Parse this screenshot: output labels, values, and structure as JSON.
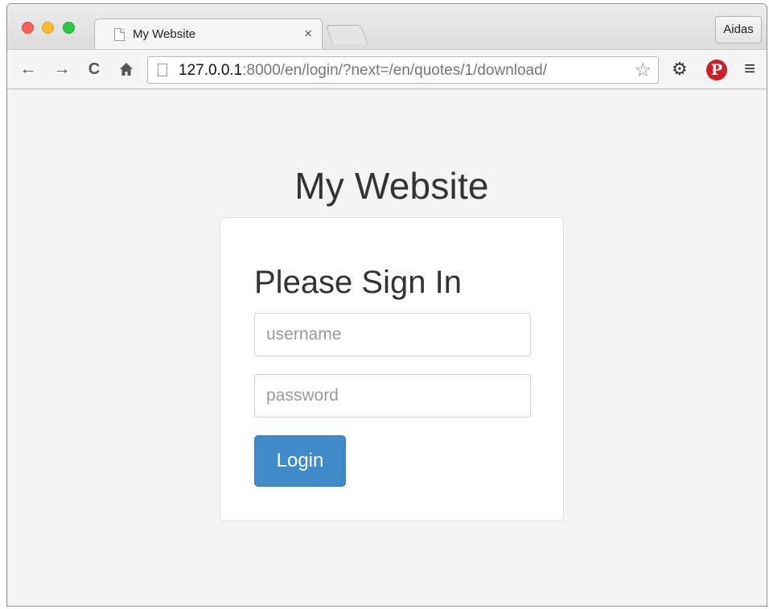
{
  "browser": {
    "tab": {
      "title": "My Website",
      "close_symbol": "×"
    },
    "profile_label": "Aidas",
    "address": {
      "host": "127.0.0.1",
      "path": ":8000/en/login/?next=/en/quotes/1/download/"
    },
    "icons": {
      "back": "arrow-left-icon",
      "forward": "arrow-right-icon",
      "reload": "reload-icon",
      "home": "home-icon",
      "bookmark": "star-icon",
      "extensions": "gear-icon",
      "pinterest": "pinterest-icon",
      "menu": "hamburger-menu-icon"
    },
    "colors": {
      "traffic_red": "#fc5f57",
      "traffic_yellow": "#fdbc2e",
      "traffic_green": "#28c840",
      "pinterest": "#cb2027"
    }
  },
  "page": {
    "site_title": "My Website",
    "login_card": {
      "heading": "Please Sign In",
      "username_placeholder": "username",
      "password_placeholder": "password",
      "submit_label": "Login"
    },
    "colors": {
      "primary_button": "#428bca",
      "background": "#f4f4f4"
    }
  }
}
